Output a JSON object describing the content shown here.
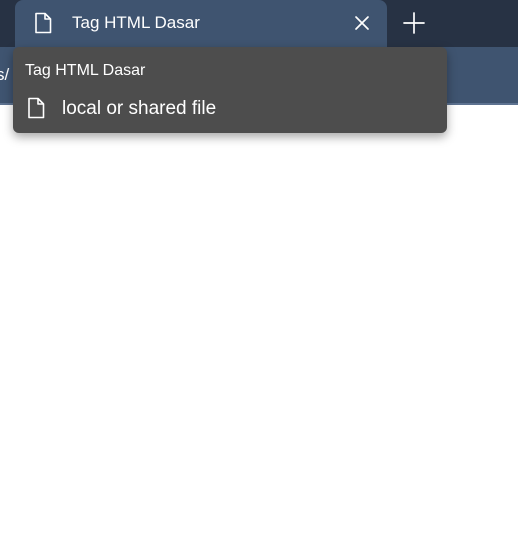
{
  "tab": {
    "title": "Tag HTML Dasar",
    "icon": "page-icon",
    "close_icon": "close-icon"
  },
  "new_tab_icon": "plus-icon",
  "toolbar": {
    "address_fragment": "s/"
  },
  "hovercard": {
    "title": "Tag HTML Dasar",
    "source_icon": "file-icon",
    "source_label": "local or shared file"
  },
  "colors": {
    "tab_strip": "#273244",
    "active_tab": "#3f5470",
    "hovercard_bg": "#4d4d4d",
    "page_bg": "#ffffff"
  }
}
